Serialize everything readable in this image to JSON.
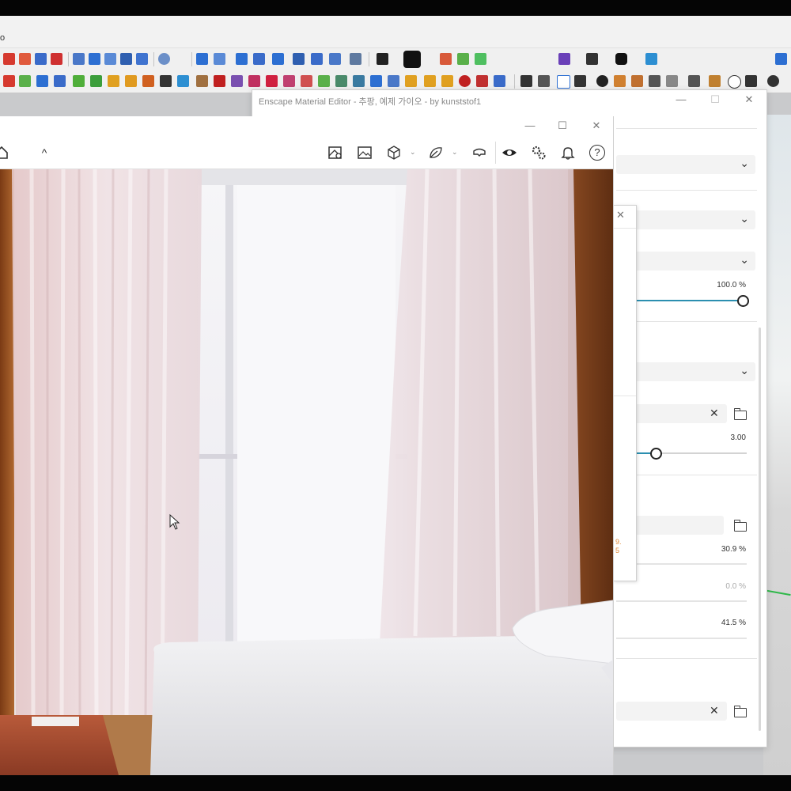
{
  "menubar": {
    "fragment": "o"
  },
  "colors": {
    "accent": "#2b8fb0",
    "axis_green": "#2fb84a",
    "toolbar_red": "#d63a2f",
    "toolbar_blue": "#2d6fd2"
  },
  "material_editor": {
    "title": "Enscape Material Editor - 추팡, 예제 가이오 - by kunststof1",
    "controls": {
      "minimize": "—",
      "maximize": "☐",
      "close": "✕"
    },
    "popup_close": "✕",
    "params": {
      "percent_1": "100.0 %",
      "value_1": "3.00",
      "percent_2": "30.9 %",
      "percent_3": "0.0 %",
      "percent_4": "41.5 %"
    },
    "slider_levels": {
      "slider_1": 1.0,
      "slider_2": 0.3
    }
  },
  "render_window": {
    "controls": {
      "minimize": "—",
      "maximize": "☐",
      "close": "✕"
    },
    "toolbar_icons": [
      "home-icon",
      "collapse-icon",
      "map-pin-icon",
      "image-icon",
      "cube-icon",
      "leaf-icon",
      "vr-headset-icon",
      "eye-icon",
      "settings-icon",
      "bell-icon",
      "help-icon"
    ],
    "collapse_glyph": "^",
    "help_glyph": "?"
  }
}
